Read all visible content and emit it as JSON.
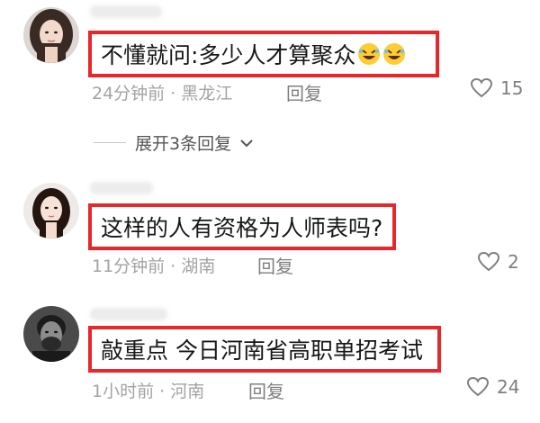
{
  "comments": [
    {
      "text": "不懂就问:多少人才算聚众",
      "emoji_count": 2,
      "emoji": "rolling-on-floor-laughing-icon",
      "time": "24分钟前",
      "location": "黑龙江",
      "reply_label": "回复",
      "likes": "15"
    },
    {
      "text": "这样的人有资格为人师表吗?",
      "time": "11分钟前",
      "location": "湖南",
      "reply_label": "回复",
      "likes": "2"
    },
    {
      "text": "敲重点 今日河南省高职单招考试",
      "time": "1小时前",
      "location": "河南",
      "reply_label": "回复",
      "likes": "24"
    }
  ],
  "expand_replies": {
    "label": "展开3条回复"
  },
  "colors": {
    "highlight_border": "#e8262b",
    "meta_text": "#a3a3a3",
    "action_text": "#7f7f7f"
  },
  "icons": {
    "like": "heart-outline-icon",
    "expand": "chevron-down-icon"
  }
}
